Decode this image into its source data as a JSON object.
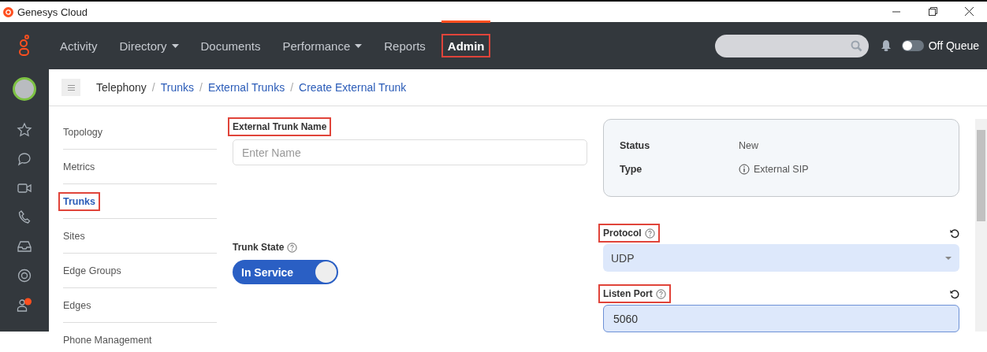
{
  "window": {
    "title": "Genesys Cloud"
  },
  "nav": {
    "items": [
      {
        "label": "Activity",
        "dropdown": false,
        "selected": false,
        "highlighted": false
      },
      {
        "label": "Directory",
        "dropdown": true,
        "selected": false,
        "highlighted": false
      },
      {
        "label": "Documents",
        "dropdown": false,
        "selected": false,
        "highlighted": false
      },
      {
        "label": "Performance",
        "dropdown": true,
        "selected": false,
        "highlighted": false
      },
      {
        "label": "Reports",
        "dropdown": false,
        "selected": false,
        "highlighted": false
      },
      {
        "label": "Admin",
        "dropdown": false,
        "selected": true,
        "highlighted": true
      }
    ],
    "queue": {
      "label": "Off Queue",
      "on": false
    }
  },
  "breadcrumb": [
    {
      "label": "Telephony",
      "link": false
    },
    {
      "separator": "/",
      "label": "Trunks",
      "link": true
    },
    {
      "separator": "/",
      "label": "External Trunks",
      "link": true
    },
    {
      "separator": "/",
      "label": "Create External Trunk",
      "link": true
    }
  ],
  "side_menu": [
    {
      "label": "Topology",
      "selected": false,
      "highlighted": false
    },
    {
      "label": "Metrics",
      "selected": false,
      "highlighted": false
    },
    {
      "label": "Trunks",
      "selected": true,
      "highlighted": true
    },
    {
      "label": "Sites",
      "selected": false,
      "highlighted": false
    },
    {
      "label": "Edge Groups",
      "selected": false,
      "highlighted": false
    },
    {
      "label": "Edges",
      "selected": false,
      "highlighted": false
    },
    {
      "label": "Phone Management",
      "selected": false,
      "highlighted": false
    }
  ],
  "name_field": {
    "label": "External Trunk Name",
    "placeholder": "Enter Name",
    "highlighted": true
  },
  "trunk_state": {
    "label": "Trunk State",
    "value": "In Service",
    "on": true
  },
  "info_panel": [
    {
      "label": "Status",
      "value": "New",
      "kind": "plain"
    },
    {
      "label": "Type",
      "value": "External SIP",
      "kind": "info"
    }
  ],
  "protocol": {
    "label": "Protocol",
    "value": "UDP",
    "highlighted": true
  },
  "listen_port": {
    "label": "Listen Port",
    "value": "5060",
    "highlighted": true
  }
}
